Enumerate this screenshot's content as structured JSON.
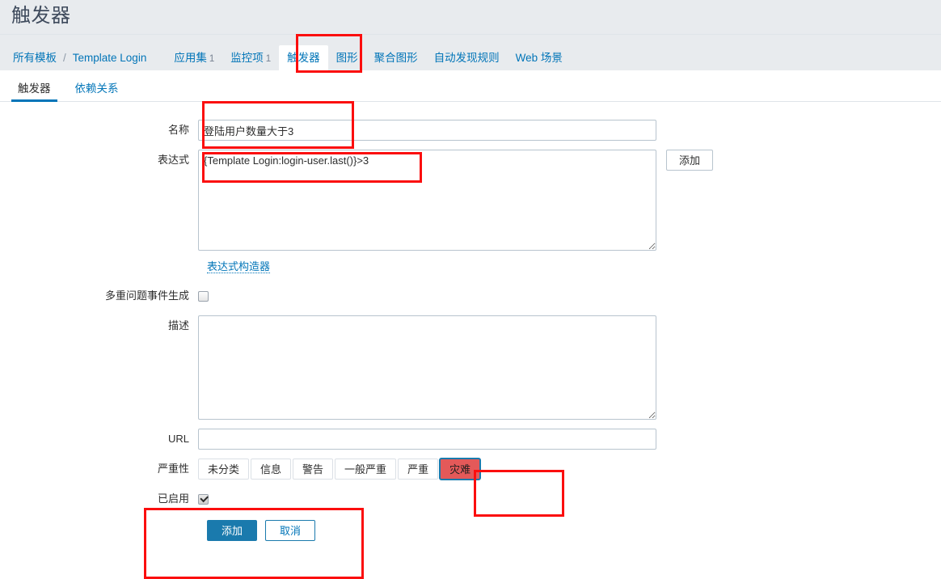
{
  "header": {
    "title": "触发器"
  },
  "nav": {
    "breadcrumb": {
      "root_label": "所有模板",
      "separator": "/",
      "current_label": "Template Login"
    },
    "items": [
      {
        "label": "应用集",
        "count": "1",
        "selected": false
      },
      {
        "label": "监控项",
        "count": "1",
        "selected": false
      },
      {
        "label": "触发器",
        "count": "",
        "selected": true
      },
      {
        "label": "图形",
        "count": "",
        "selected": false
      },
      {
        "label": "聚合图形",
        "count": "",
        "selected": false
      },
      {
        "label": "自动发现规则",
        "count": "",
        "selected": false
      },
      {
        "label": "Web 场景",
        "count": "",
        "selected": false
      }
    ]
  },
  "subtabs": [
    {
      "label": "触发器",
      "active": true
    },
    {
      "label": "依赖关系",
      "active": false
    }
  ],
  "form": {
    "name": {
      "label": "名称",
      "value": "登陆用户数量大于3",
      "placeholder": ""
    },
    "expression": {
      "label": "表达式",
      "value": "{Template Login:login-user.last()}>3",
      "placeholder": "",
      "add_button_label": "添加",
      "constructor_link_label": "表达式构造器"
    },
    "multiple_events": {
      "label": "多重问题事件生成",
      "checked": false
    },
    "description": {
      "label": "描述",
      "value": "",
      "placeholder": ""
    },
    "url": {
      "label": "URL",
      "value": "",
      "placeholder": ""
    },
    "severity": {
      "label": "严重性",
      "options": [
        {
          "label": "未分类",
          "selected": false
        },
        {
          "label": "信息",
          "selected": false
        },
        {
          "label": "警告",
          "selected": false
        },
        {
          "label": "一般严重",
          "selected": false
        },
        {
          "label": "严重",
          "selected": false
        },
        {
          "label": "灾难",
          "selected": true
        }
      ],
      "selected_value": "灾难",
      "selected_color": "#e45959"
    },
    "enabled": {
      "label": "已启用",
      "checked": true
    },
    "actions": {
      "submit_label": "添加",
      "cancel_label": "取消"
    }
  },
  "annotations": {
    "color": "#fb0e0e",
    "boxes": [
      {
        "name": "triggers-tab",
        "target": "触发器"
      },
      {
        "name": "name-field",
        "target": "登陆用户数量大于3"
      },
      {
        "name": "expression-field",
        "target": "{Template Login:login-user.last()}>3"
      },
      {
        "name": "severity-disaster",
        "target": "灾难"
      },
      {
        "name": "enabled-and-actions",
        "target": "已启用 / 添加 / 取消"
      }
    ]
  },
  "colors": {
    "accent": "#0275b8",
    "header_bg": "#e8ebee",
    "disaster": "#e45959",
    "annotation": "#fb0e0e"
  }
}
